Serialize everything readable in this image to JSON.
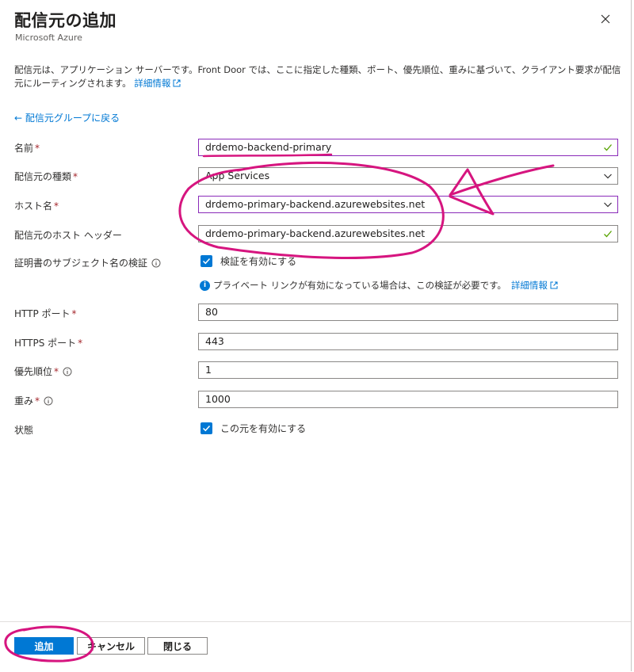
{
  "header": {
    "title": "配信元の追加",
    "subtitle": "Microsoft Azure",
    "close_icon": "close-icon"
  },
  "description": {
    "text": "配信元は、アプリケーション サーバーです。Front Door では、ここに指定した種類、ポート、優先順位、重みに基づいて、クライアント要求が配信元にルーティングされます。",
    "link": "詳細情報"
  },
  "back_link": "← 配信元グループに戻る",
  "form": {
    "name": {
      "label": "名前",
      "required_mark": "*",
      "value": "drdemo-backend-primary"
    },
    "origin_type": {
      "label": "配信元の種類",
      "required_mark": "*",
      "value": "App Services"
    },
    "host_name": {
      "label": "ホスト名",
      "required_mark": "*",
      "value": "drdemo-primary-backend.azurewebsites.net"
    },
    "host_header": {
      "label": "配信元のホスト ヘッダー",
      "value": "drdemo-primary-backend.azurewebsites.net"
    },
    "cert_check": {
      "label": "証明書のサブジェクト名の検証",
      "checkbox_label": "検証を有効にする",
      "checked": true,
      "info_text": "プライベート リンクが有効になっている場合は、この検証が必要です。",
      "info_link": "詳細情報"
    },
    "http_port": {
      "label": "HTTP ポート",
      "required_mark": "*",
      "value": "80"
    },
    "https_port": {
      "label": "HTTPS ポート",
      "required_mark": "*",
      "value": "443"
    },
    "priority": {
      "label": "優先順位",
      "required_mark": "*",
      "value": "1"
    },
    "weight": {
      "label": "重み",
      "required_mark": "*",
      "value": "1000"
    },
    "status": {
      "label": "状態",
      "checkbox_label": "この元を有効にする",
      "checked": true
    }
  },
  "footer": {
    "add": "追加",
    "cancel": "キャンセル",
    "close": "閉じる"
  },
  "colors": {
    "accent": "#0078d4",
    "annotation": "#d6157f",
    "valid": "#57a300",
    "required": "#a4262c"
  }
}
